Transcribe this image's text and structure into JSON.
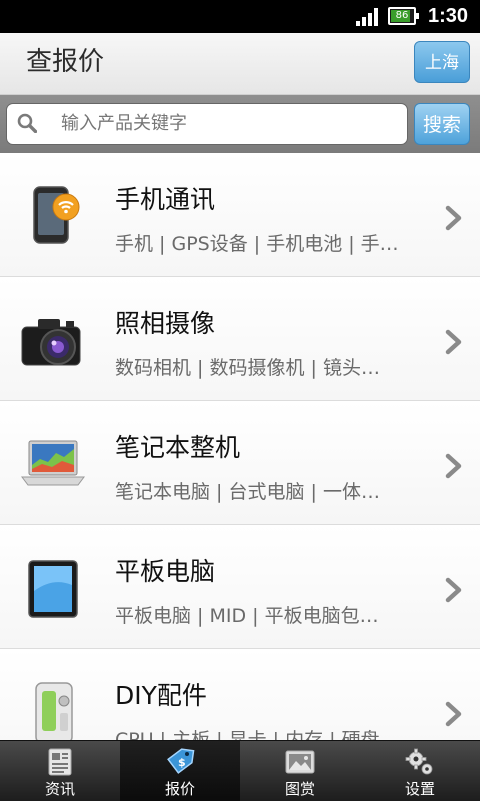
{
  "status_bar": {
    "battery": "86",
    "time": "1:30"
  },
  "header": {
    "title": "查报价",
    "city_button": "上海"
  },
  "search": {
    "placeholder": "输入产品关键字",
    "button": "搜索"
  },
  "categories": [
    {
      "name": "手机通讯",
      "sub": "手机 | GPS设备 | 手机电池 | 手…",
      "icon": "phone-wifi-icon"
    },
    {
      "name": "照相摄像",
      "sub": "数码相机 | 数码摄像机 | 镜头…",
      "icon": "camera-icon"
    },
    {
      "name": "笔记本整机",
      "sub": "笔记本电脑 | 台式电脑 | 一体…",
      "icon": "laptop-icon"
    },
    {
      "name": "平板电脑",
      "sub": "平板电脑 | MID | 平板电脑包…",
      "icon": "tablet-icon"
    },
    {
      "name": "DIY配件",
      "sub": "CPU | 主板 | 显卡 | 内存 | 硬盘",
      "icon": "pc-case-icon"
    }
  ],
  "tabs": [
    {
      "label": "资讯",
      "icon": "news-icon",
      "active": false
    },
    {
      "label": "报价",
      "icon": "price-tag-icon",
      "active": true
    },
    {
      "label": "图赏",
      "icon": "picture-icon",
      "active": false
    },
    {
      "label": "设置",
      "icon": "gear-icon",
      "active": false
    }
  ]
}
